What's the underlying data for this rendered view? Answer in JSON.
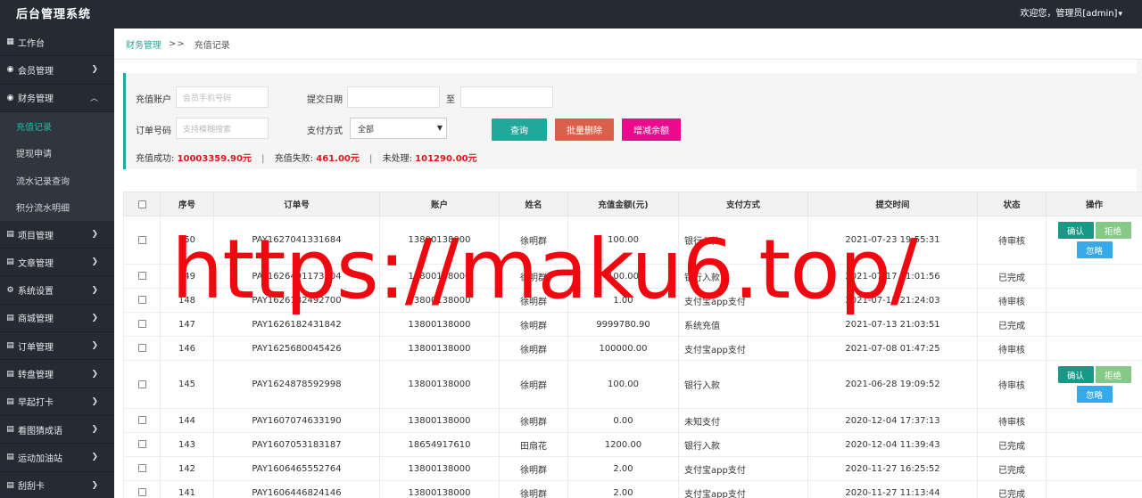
{
  "app": {
    "title": "后台管理系统",
    "user_greeting": "欢迎您，管理员[admin]"
  },
  "sidebar": {
    "workbench": "工作台",
    "members": "会员管理",
    "finance": "财务管理",
    "finance_sub": [
      "充值记录",
      "提现申请",
      "流水记录查询",
      "积分流水明细"
    ],
    "others": [
      "项目管理",
      "文章管理",
      "系统设置",
      "商城管理",
      "订单管理",
      "转盘管理",
      "早起打卡",
      "看图猜成语",
      "运动加油站",
      "刮刮卡"
    ]
  },
  "breadcrumb": {
    "parent": "财务管理",
    "separator": ">>",
    "current": "充值记录"
  },
  "filter": {
    "account_label": "充值账户",
    "account_placeholder": "会员手机号码",
    "date_label": "提交日期",
    "date_to": "至",
    "order_label": "订单号码",
    "order_placeholder": "支持模糊搜索",
    "pay_label": "支付方式",
    "pay_selected": "全部",
    "query": "查询",
    "batch_delete": "批量删除",
    "adjust_balance": "增减余额"
  },
  "stats": {
    "success_label": "充值成功:",
    "success_value": "10003359.90元",
    "fail_label": "充值失败:",
    "fail_value": "461.00元",
    "pending_label": "未处理:",
    "pending_value": "101290.00元"
  },
  "table": {
    "headers": [
      "序号",
      "订单号",
      "账户",
      "姓名",
      "充值金额(元)",
      "支付方式",
      "提交时间",
      "状态",
      "操作"
    ],
    "actions": {
      "confirm": "确认",
      "reject": "拒绝",
      "ignore": "忽略"
    },
    "rows": [
      {
        "id": "150",
        "order": "PAY1627041331684",
        "account": "13800138000",
        "name": "徐明群",
        "amount": "100.00",
        "method": "银行入款",
        "time": "2021-07-23 19:55:31",
        "status": "待审核",
        "actions": true
      },
      {
        "id": "149",
        "order": "PAY1626491173504",
        "account": "13800138000",
        "name": "徐明群",
        "amount": "100.00",
        "method": "银行入款",
        "time": "2021-07-17 11:01:56",
        "status": "已完成",
        "actions": false
      },
      {
        "id": "148",
        "order": "PAY1626182492700",
        "account": "13800138000",
        "name": "徐明群",
        "amount": "1.00",
        "method": "支付宝app支付",
        "time": "2021-07-13 21:24:03",
        "status": "待审核",
        "actions": false
      },
      {
        "id": "147",
        "order": "PAY1626182431842",
        "account": "13800138000",
        "name": "徐明群",
        "amount": "9999780.90",
        "method": "系统充值",
        "time": "2021-07-13 21:03:51",
        "status": "已完成",
        "actions": false
      },
      {
        "id": "146",
        "order": "PAY1625680045426",
        "account": "13800138000",
        "name": "徐明群",
        "amount": "100000.00",
        "method": "支付宝app支付",
        "time": "2021-07-08 01:47:25",
        "status": "待审核",
        "actions": false
      },
      {
        "id": "145",
        "order": "PAY1624878592998",
        "account": "13800138000",
        "name": "徐明群",
        "amount": "100.00",
        "method": "银行入款",
        "time": "2021-06-28 19:09:52",
        "status": "待审核",
        "actions": true
      },
      {
        "id": "144",
        "order": "PAY1607074633190",
        "account": "13800138000",
        "name": "徐明群",
        "amount": "0.00",
        "method": "未知支付",
        "time": "2020-12-04 17:37:13",
        "status": "待审核",
        "actions": false
      },
      {
        "id": "143",
        "order": "PAY1607053183187",
        "account": "18654917610",
        "name": "田扇花",
        "amount": "1200.00",
        "method": "银行入款",
        "time": "2020-12-04 11:39:43",
        "status": "已完成",
        "actions": false
      },
      {
        "id": "142",
        "order": "PAY1606465552764",
        "account": "13800138000",
        "name": "徐明群",
        "amount": "2.00",
        "method": "支付宝app支付",
        "time": "2020-11-27 16:25:52",
        "status": "已完成",
        "actions": false
      },
      {
        "id": "141",
        "order": "PAY1606446824146",
        "account": "13800138000",
        "name": "徐明群",
        "amount": "2.00",
        "method": "支付宝app支付",
        "time": "2020-11-27 11:13:44",
        "status": "已完成",
        "actions": false
      }
    ]
  },
  "watermark": "https://maku6.top/",
  "colors": {
    "accent": "#22a89a",
    "topbar": "#262b33",
    "danger_text": "#e0161b",
    "query_btn": "#22a89a",
    "delete_btn": "#d9604a",
    "adjust_btn": "#ec0a8c",
    "watermark": "#f0070f"
  }
}
